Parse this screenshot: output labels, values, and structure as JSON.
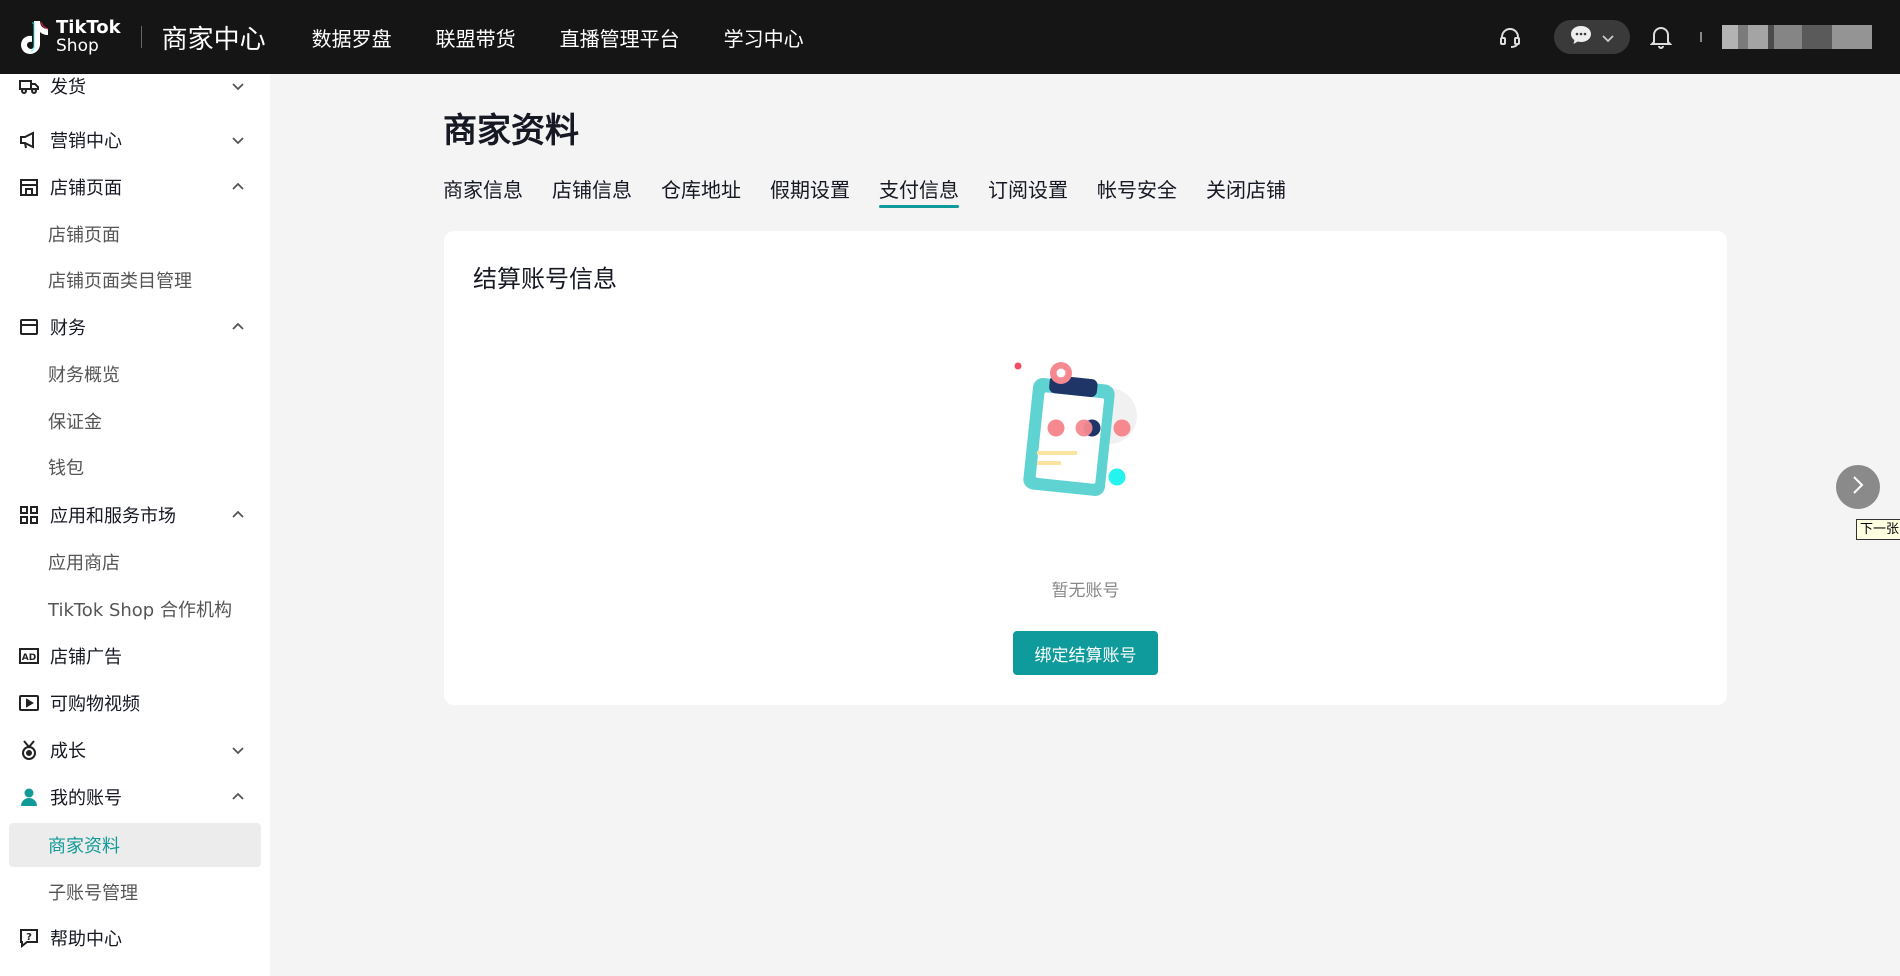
{
  "topbar": {
    "logo_line1": "TikTok",
    "logo_line2": "Shop",
    "center_title": "商家中心",
    "nav": [
      "数据罗盘",
      "联盟带货",
      "直播管理平台",
      "学习中心"
    ]
  },
  "sidebar": {
    "partial_top": "发货",
    "items": [
      {
        "label": "营销中心"
      },
      {
        "label": "店铺页面"
      },
      {
        "label": "店铺页面"
      },
      {
        "label": "店铺页面类目管理"
      },
      {
        "label": "财务"
      },
      {
        "label": "财务概览"
      },
      {
        "label": "保证金"
      },
      {
        "label": "钱包"
      },
      {
        "label": "应用和服务市场"
      },
      {
        "label": "应用商店"
      },
      {
        "label": "TikTok Shop 合作机构"
      },
      {
        "label": "店铺广告"
      },
      {
        "label": "可购物视频"
      },
      {
        "label": "成长"
      },
      {
        "label": "我的账号"
      },
      {
        "label": "商家资料"
      },
      {
        "label": "子账号管理"
      },
      {
        "label": "帮助中心"
      }
    ]
  },
  "main": {
    "title": "商家资料",
    "tabs": [
      "商家信息",
      "店铺信息",
      "仓库地址",
      "假期设置",
      "支付信息",
      "订阅设置",
      "帐号安全",
      "关闭店铺"
    ],
    "active_tab": "支付信息",
    "card_title": "结算账号信息",
    "empty_text": "暂无账号",
    "bind_button": "绑定结算账号"
  },
  "tooltip": "下一张",
  "colors": {
    "accent": "#0f9b9b",
    "topbar_bg": "#151515",
    "page_bg": "#f4f4f4"
  }
}
